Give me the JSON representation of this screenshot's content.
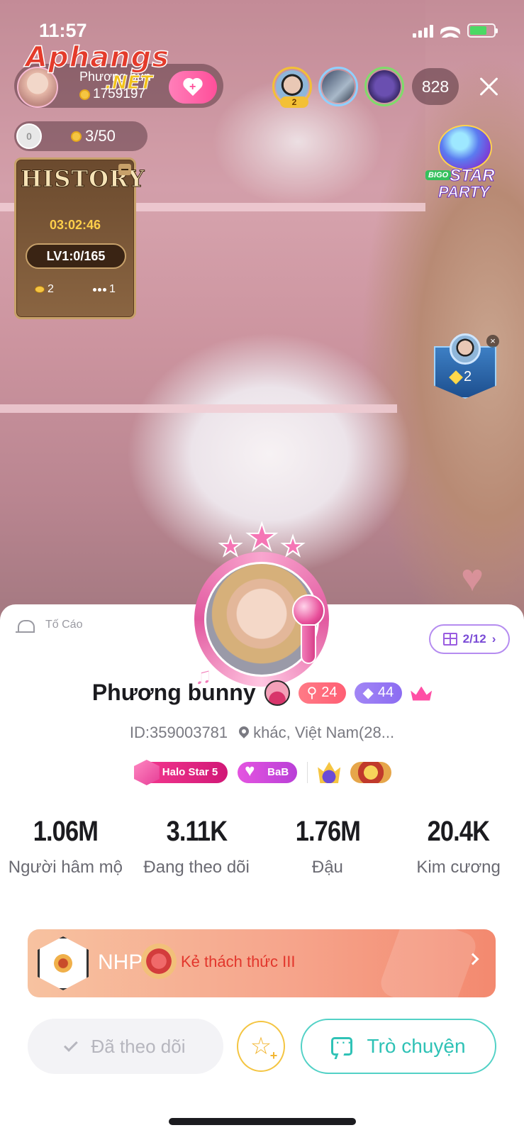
{
  "status_bar": {
    "time": "11:57"
  },
  "watermark": {
    "brand": "Aphangs",
    "suffix": ".NET"
  },
  "host": {
    "name": "Phương bun",
    "coins": "1759197"
  },
  "top_viewers": {
    "rank_badge": "2",
    "count": "828"
  },
  "beans": {
    "level": "0",
    "progress": "3/50"
  },
  "history": {
    "title": "HISTORY",
    "timer": "03:02:46",
    "level": "LV1:0/165",
    "coin_count": "2",
    "item_count": "1"
  },
  "star_party": {
    "brand": "BIGO",
    "line1": "STAR",
    "line2": "PARTY"
  },
  "shield_badge": {
    "value": "2"
  },
  "profile": {
    "report_label": "Tố Cáo",
    "gift_count": "2/12",
    "display_name": "Phương bunny",
    "user_level": "24",
    "wealth_level": "44",
    "id": "ID:359003781",
    "location": "khác, Việt Nam(28...",
    "halo_badge": "Halo Star 5",
    "bab_badge": "BaB",
    "stats": [
      {
        "value": "1.06M",
        "label": "Người hâm mộ"
      },
      {
        "value": "3.11K",
        "label": "Đang theo dõi"
      },
      {
        "value": "1.76M",
        "label": "Đậu"
      },
      {
        "value": "20.4K",
        "label": "Kim cương"
      }
    ],
    "family": {
      "name": "NHP",
      "rank": "Kẻ thách thức III"
    },
    "actions": {
      "followed_label": "Đã theo dõi",
      "chat_label": "Trò chuyện"
    }
  },
  "colors": {
    "accent_pink": "#ff4f9a",
    "chat_teal": "#2fc2b6",
    "gift_purple": "#7a4bd6",
    "family_rank_red": "#e2362c"
  }
}
